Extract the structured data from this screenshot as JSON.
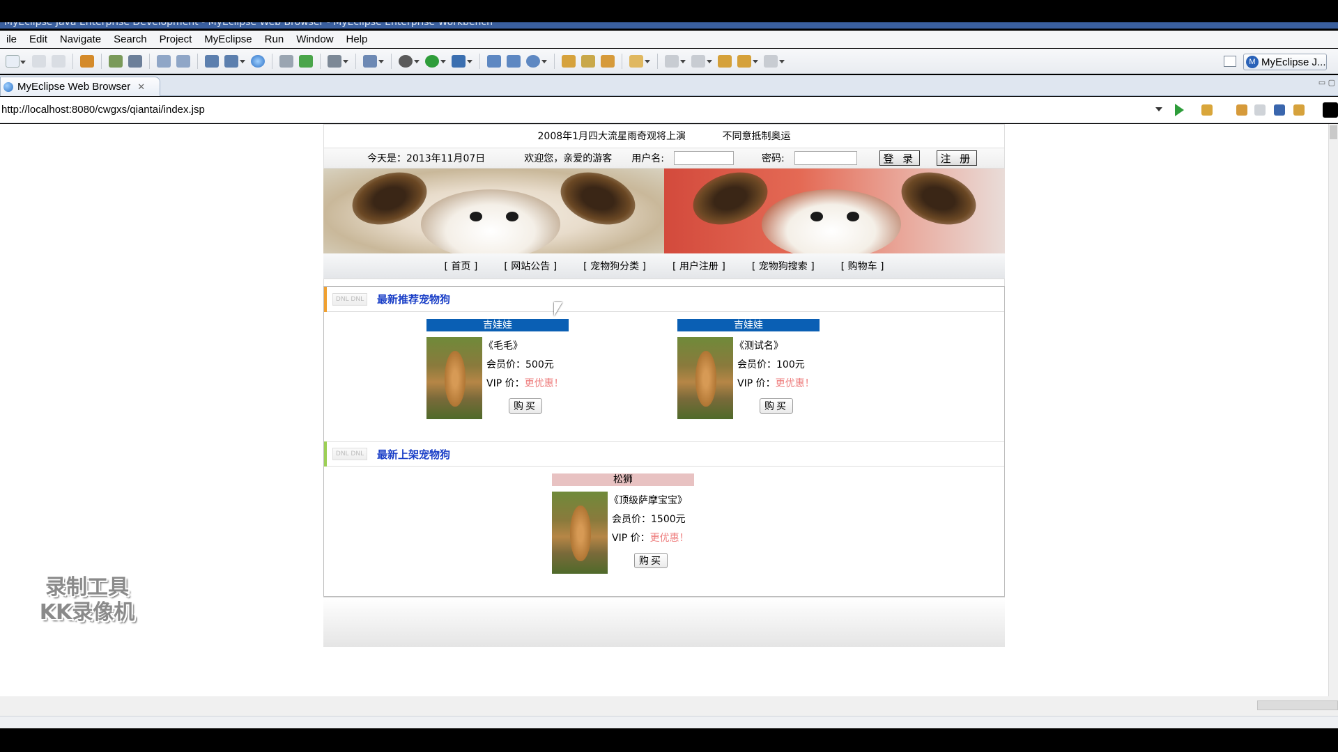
{
  "window": {
    "title": "MyEclipse Java Enterprise Development - MyEclipse Web Browser - MyEclipse Enterprise Workbench"
  },
  "menu": [
    "ile",
    "Edit",
    "Navigate",
    "Search",
    "Project",
    "MyEclipse",
    "Run",
    "Window",
    "Help"
  ],
  "perspective": {
    "label": "MyEclipse J..."
  },
  "editor_tab": {
    "label": "MyEclipse Web Browser",
    "close": "✕"
  },
  "browser": {
    "url": "http://localhost:8080/cwgxs/qiantai/index.jsp"
  },
  "page": {
    "news": [
      "2008年1月四大流星雨奇观将上演",
      "不同意抵制奥运"
    ],
    "login": {
      "date_text": "今天是：2013年11月07日",
      "welcome": "欢迎您，亲爱的游客",
      "username_label": "用户名:",
      "password_label": "密码:",
      "login_button": "登 录",
      "register_button": "注 册"
    },
    "nav": [
      "[ 首页 ]",
      "[ 网站公告 ]",
      "[ 宠物狗分类 ]",
      "[ 用户注册 ]",
      "[ 宠物狗搜索 ]",
      "[ 购物车 ]"
    ],
    "recommended": {
      "title": "最新推荐宠物狗",
      "accent": "#f0a030",
      "items": [
        {
          "category": "吉娃娃",
          "category_color": "#0a5fb4",
          "name": "《毛毛》",
          "member_price": "会员价：500元",
          "vip_price_label": "VIP 价：",
          "vip_price_value": "更优惠！",
          "buy": "购买"
        },
        {
          "category": "吉娃娃",
          "category_color": "#0a5fb4",
          "name": "《测试名》",
          "member_price": "会员价：100元",
          "vip_price_label": "VIP 价：",
          "vip_price_value": "更优惠！",
          "buy": "购买"
        }
      ]
    },
    "newest": {
      "title": "最新上架宠物狗",
      "accent": "#9ccf55",
      "items": [
        {
          "category": "松狮",
          "category_color": "#e8c2c2",
          "name": "《顶级萨摩宝宝》",
          "member_price": "会员价：1500元",
          "vip_price_label": "VIP 价：",
          "vip_price_value": "更优惠！",
          "buy": "购买"
        }
      ]
    }
  },
  "watermark": [
    "录制工具",
    "KK录像机"
  ]
}
